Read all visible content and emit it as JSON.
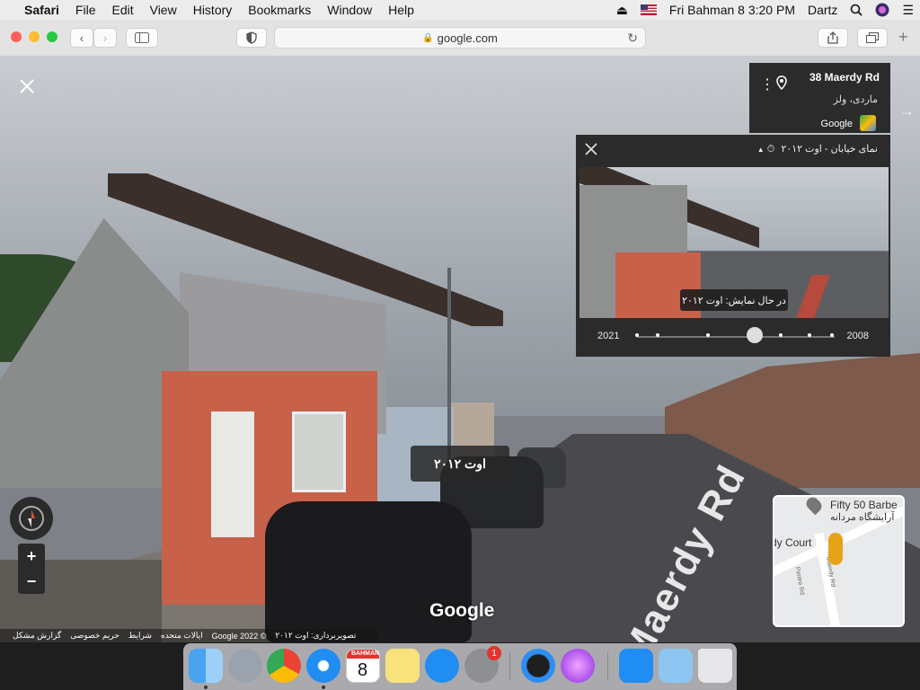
{
  "menubar": {
    "app": "Safari",
    "items": [
      "File",
      "Edit",
      "View",
      "History",
      "Bookmarks",
      "Window",
      "Help"
    ],
    "datetime": "Fri Bahman 8  3:20 PM",
    "user": "Dartz"
  },
  "toolbar": {
    "url": "google.com"
  },
  "streetview": {
    "date_overlay": "اوت ۲۰۱۲",
    "google_logo": "Google",
    "road_marking": "Maerdy Rd",
    "zoom_in": "+",
    "zoom_out": "−",
    "footer": {
      "report": "گزارش مشکل",
      "privacy": "حریم خصوصی",
      "terms": "شرایط",
      "region": "ایالات متحده",
      "copyright": "© 2022 Google",
      "capture": "تصویربرداری: اوت ۲۰۱۲"
    }
  },
  "address_card": {
    "title": "38 Maerdy Rd",
    "subtitle": "ماردی، ولز",
    "google_label": "Google"
  },
  "time_machine": {
    "title": "نمای خیابان - اوت ۲۰۱۲",
    "tooltip": "در حال نمایش: اوت ۲۰۱۲",
    "year_start": "2021",
    "year_end": "2008"
  },
  "minimap": {
    "place1": "Fifty 50 Barbe",
    "place2": "آرایشگاه مردانه",
    "place3": "rdy Court",
    "road1": "Pentre Rd",
    "road2": "Maerdy Rd"
  },
  "dock": {
    "calendar_month": "BAHMAN",
    "calendar_day": "8",
    "badge": "1"
  },
  "colors": {
    "panel_bg": "#2b2b2b",
    "accent_peg": "#e8a217",
    "badge": "#e5322d"
  }
}
